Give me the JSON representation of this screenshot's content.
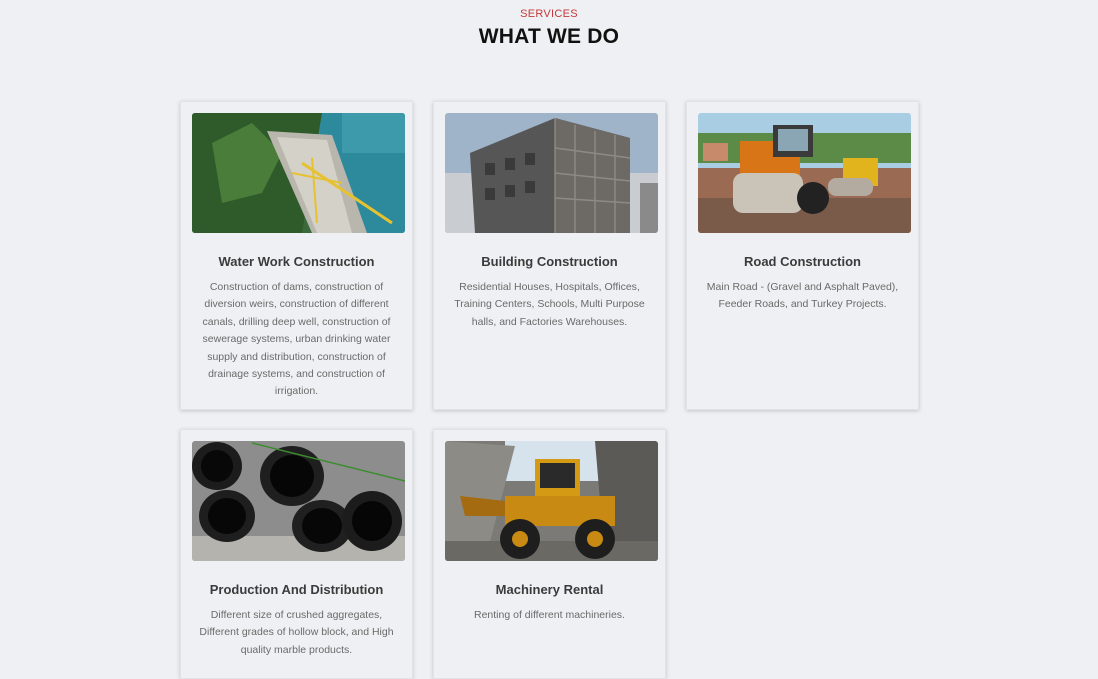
{
  "header": {
    "eyebrow": "SERVICES",
    "title": "WHAT WE DO"
  },
  "services": [
    {
      "title": "Water Work Construction",
      "description": "Construction of dams, construction of diversion weirs, construction of different canals, drilling deep well, construction of sewerage systems, urban drinking water supply and distribution, construction of drainage systems, and construction of irrigation.",
      "image": "dam-construction-photo"
    },
    {
      "title": "Building Construction",
      "description": "Residential Houses, Hospitals, Offices, Training Centers, Schools, Multi Purpose halls, and Factories Warehouses.",
      "image": "building-scaffolding-photo"
    },
    {
      "title": "Road Construction",
      "description": "Main Road - (Gravel and Asphalt Paved), Feeder Roads, and Turkey Projects.",
      "image": "road-roller-photo"
    },
    {
      "title": "Production And Distribution",
      "description": "Different size of crushed aggregates, Different grades of hollow block, and High quality marble products.",
      "image": "black-pipes-photo"
    },
    {
      "title": "Machinery Rental",
      "description": "Renting of different machineries.",
      "image": "wheel-loader-photo"
    }
  ],
  "colors": {
    "accent": "#c4393a",
    "background": "#eff0f3",
    "title": "#111111",
    "body_text": "#6a6a6a"
  }
}
